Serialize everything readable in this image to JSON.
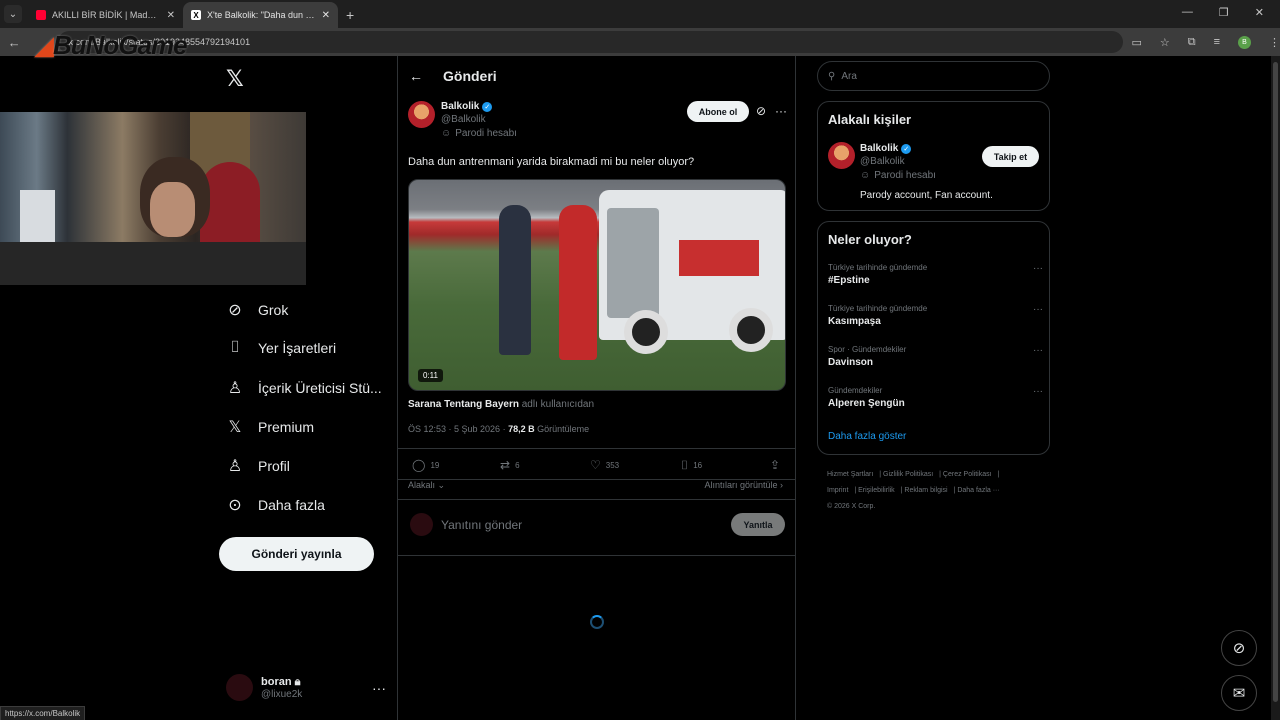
{
  "browser": {
    "tabs": [
      {
        "title": "AKILLI BİR BİDİK | Madara Oldu",
        "active": false
      },
      {
        "title": "X'te Balkolik: \"Daha dun antrenm",
        "active": true
      }
    ],
    "url": "x.com/Balkolik/status/2019348554792194101",
    "status_url": "https://x.com/Balkolik"
  },
  "watermark": "BuNoGame",
  "nav": {
    "items": [
      {
        "label": "Grok",
        "icon": "grok-icon"
      },
      {
        "label": "Yer İşaretleri",
        "icon": "bookmark-icon"
      },
      {
        "label": "İçerik Üreticisi Stü...",
        "icon": "creator-studio-icon"
      },
      {
        "label": "Premium",
        "icon": "x-icon"
      },
      {
        "label": "Profil",
        "icon": "person-icon"
      },
      {
        "label": "Daha fazla",
        "icon": "more-circle-icon"
      }
    ],
    "post_button": "Gönderi yayınla",
    "account": {
      "name": "boran",
      "handle": "@lixue2k"
    }
  },
  "post": {
    "header": "Gönderi",
    "author_name": "Balkolik",
    "author_handle": "@Balkolik",
    "parody_label": "Parodi hesabı",
    "subscribe": "Abone ol",
    "text": "Daha dun antrenmani yarida birakmadi mi bu neler oluyor?",
    "video_time": "0:11",
    "source_name": "Sarana Tentang Bayern",
    "source_suffix": "adlı kullanıcıdan",
    "timestamp": "ÖS 12:53 · 5 Şub 2026 · ",
    "views": "78,2 B",
    "views_label": " Görüntüleme",
    "counts": {
      "replies": "19",
      "reposts": "6",
      "likes": "353",
      "bookmarks": "16"
    },
    "relevance": "Alakalı",
    "quotes_link": "Alıntıları görüntüle",
    "reply_placeholder": "Yanıtını gönder",
    "reply_button": "Yanıtla"
  },
  "sidebar": {
    "search_placeholder": "Ara",
    "related_title": "Alakalı kişiler",
    "related": {
      "name": "Balkolik",
      "handle": "@Balkolik",
      "parody_label": "Parodi hesabı",
      "bio": "Parody account, Fan account.",
      "follow": "Takip et"
    },
    "trends_title": "Neler oluyor?",
    "trends": [
      {
        "context": "Türkiye tarihinde gündemde",
        "title": "#Epstine"
      },
      {
        "context": "Türkiye tarihinde gündemde",
        "title": "Kasımpaşa"
      },
      {
        "context": "Spor · Gündemdekiler",
        "title": "Davinson"
      },
      {
        "context": "Gündemdekiler",
        "title": "Alperen Şengün"
      }
    ],
    "show_more": "Daha fazla göster",
    "footer": [
      "Hizmet Şartları",
      "Gizlilik Politikası",
      "Çerez Politikası",
      "Imprint",
      "Erişilebilirlik",
      "Reklam bilgisi",
      "Daha fazla ···",
      "© 2026 X Corp."
    ]
  },
  "colors": {
    "accent": "#1d9bf0",
    "background": "#000000",
    "border": "#2f3336",
    "muted": "#71767b"
  }
}
